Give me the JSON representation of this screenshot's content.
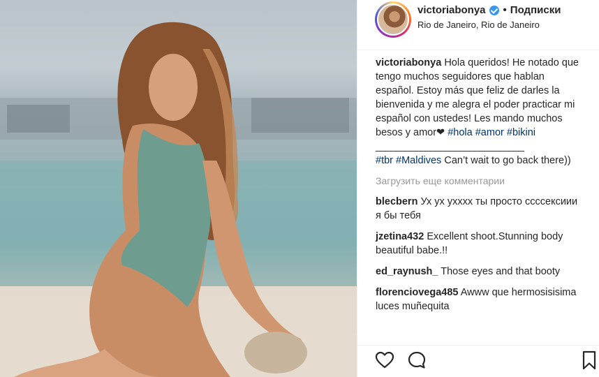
{
  "post": {
    "username": "victoriabonya",
    "follow_separator": "•",
    "follow_label": "Подписки",
    "location": "Rio de Janeiro, Rio de Janeiro",
    "caption": {
      "username": "victoriabonya",
      "text": "Hola queridos! He notado que tengo muchos seguidores que hablan español. Estoy más que feliz de darles la bienvenida y me alegra el poder practicar mi español con ustedes! Les mando muchos besos y amor❤ ",
      "tags": [
        "#hola",
        "#amor",
        "#bikini"
      ],
      "divider": "______________________________",
      "tags2": [
        "#tbr",
        "#Maldives"
      ],
      "text2": " Can’t wait to go back there))"
    },
    "load_more": "Загрузить еще комментарии",
    "comments": [
      {
        "username": "blecbern",
        "text": "Ух ух ухххх ты просто ссссексиии я бы тебя"
      },
      {
        "username": "jzetina432",
        "text": "Excellent shoot.Stunning body beautiful babe.!!"
      },
      {
        "username": "ed_raynush_",
        "text": "Those eyes and that booty"
      },
      {
        "username": "florenciovega485",
        "text": "Awww que hermosisisima luces muñequita"
      }
    ],
    "icons": {
      "like": "heart-icon",
      "comment": "comment-icon",
      "save": "bookmark-icon",
      "verified": "verified-badge-icon"
    },
    "colors": {
      "link": "#003569",
      "verified": "#3897f0",
      "muted": "#999999"
    }
  }
}
